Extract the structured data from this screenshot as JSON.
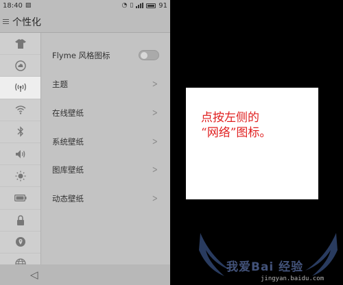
{
  "status_bar": {
    "time": "18:40",
    "battery": "91"
  },
  "app_bar": {
    "title": "个性化"
  },
  "sidebar": {
    "items": [
      {
        "icon": "shirt-icon"
      },
      {
        "icon": "cloud-icon"
      },
      {
        "icon": "network-icon",
        "selected": true
      },
      {
        "icon": "wifi-icon"
      },
      {
        "icon": "bluetooth-icon"
      },
      {
        "icon": "volume-icon"
      },
      {
        "icon": "brightness-icon"
      },
      {
        "icon": "battery-icon"
      },
      {
        "icon": "lock-icon"
      },
      {
        "icon": "location-icon"
      },
      {
        "icon": "globe-icon"
      }
    ]
  },
  "settings": {
    "rows": [
      {
        "label": "Flyme 风格图标",
        "control": "toggle",
        "on": false
      },
      {
        "label": "主题",
        "control": "chevron"
      },
      {
        "label": "在线壁纸",
        "control": "chevron"
      },
      {
        "label": "系统壁纸",
        "control": "chevron"
      },
      {
        "label": "图库壁纸",
        "control": "chevron"
      },
      {
        "label": "动态壁纸",
        "control": "chevron"
      }
    ]
  },
  "callout": {
    "text": "点按左侧的\n“网络”图标。",
    "color": "#e02020"
  },
  "watermark": {
    "text": "我爱Bai 经验",
    "url": "jingyan.baidu.com"
  }
}
